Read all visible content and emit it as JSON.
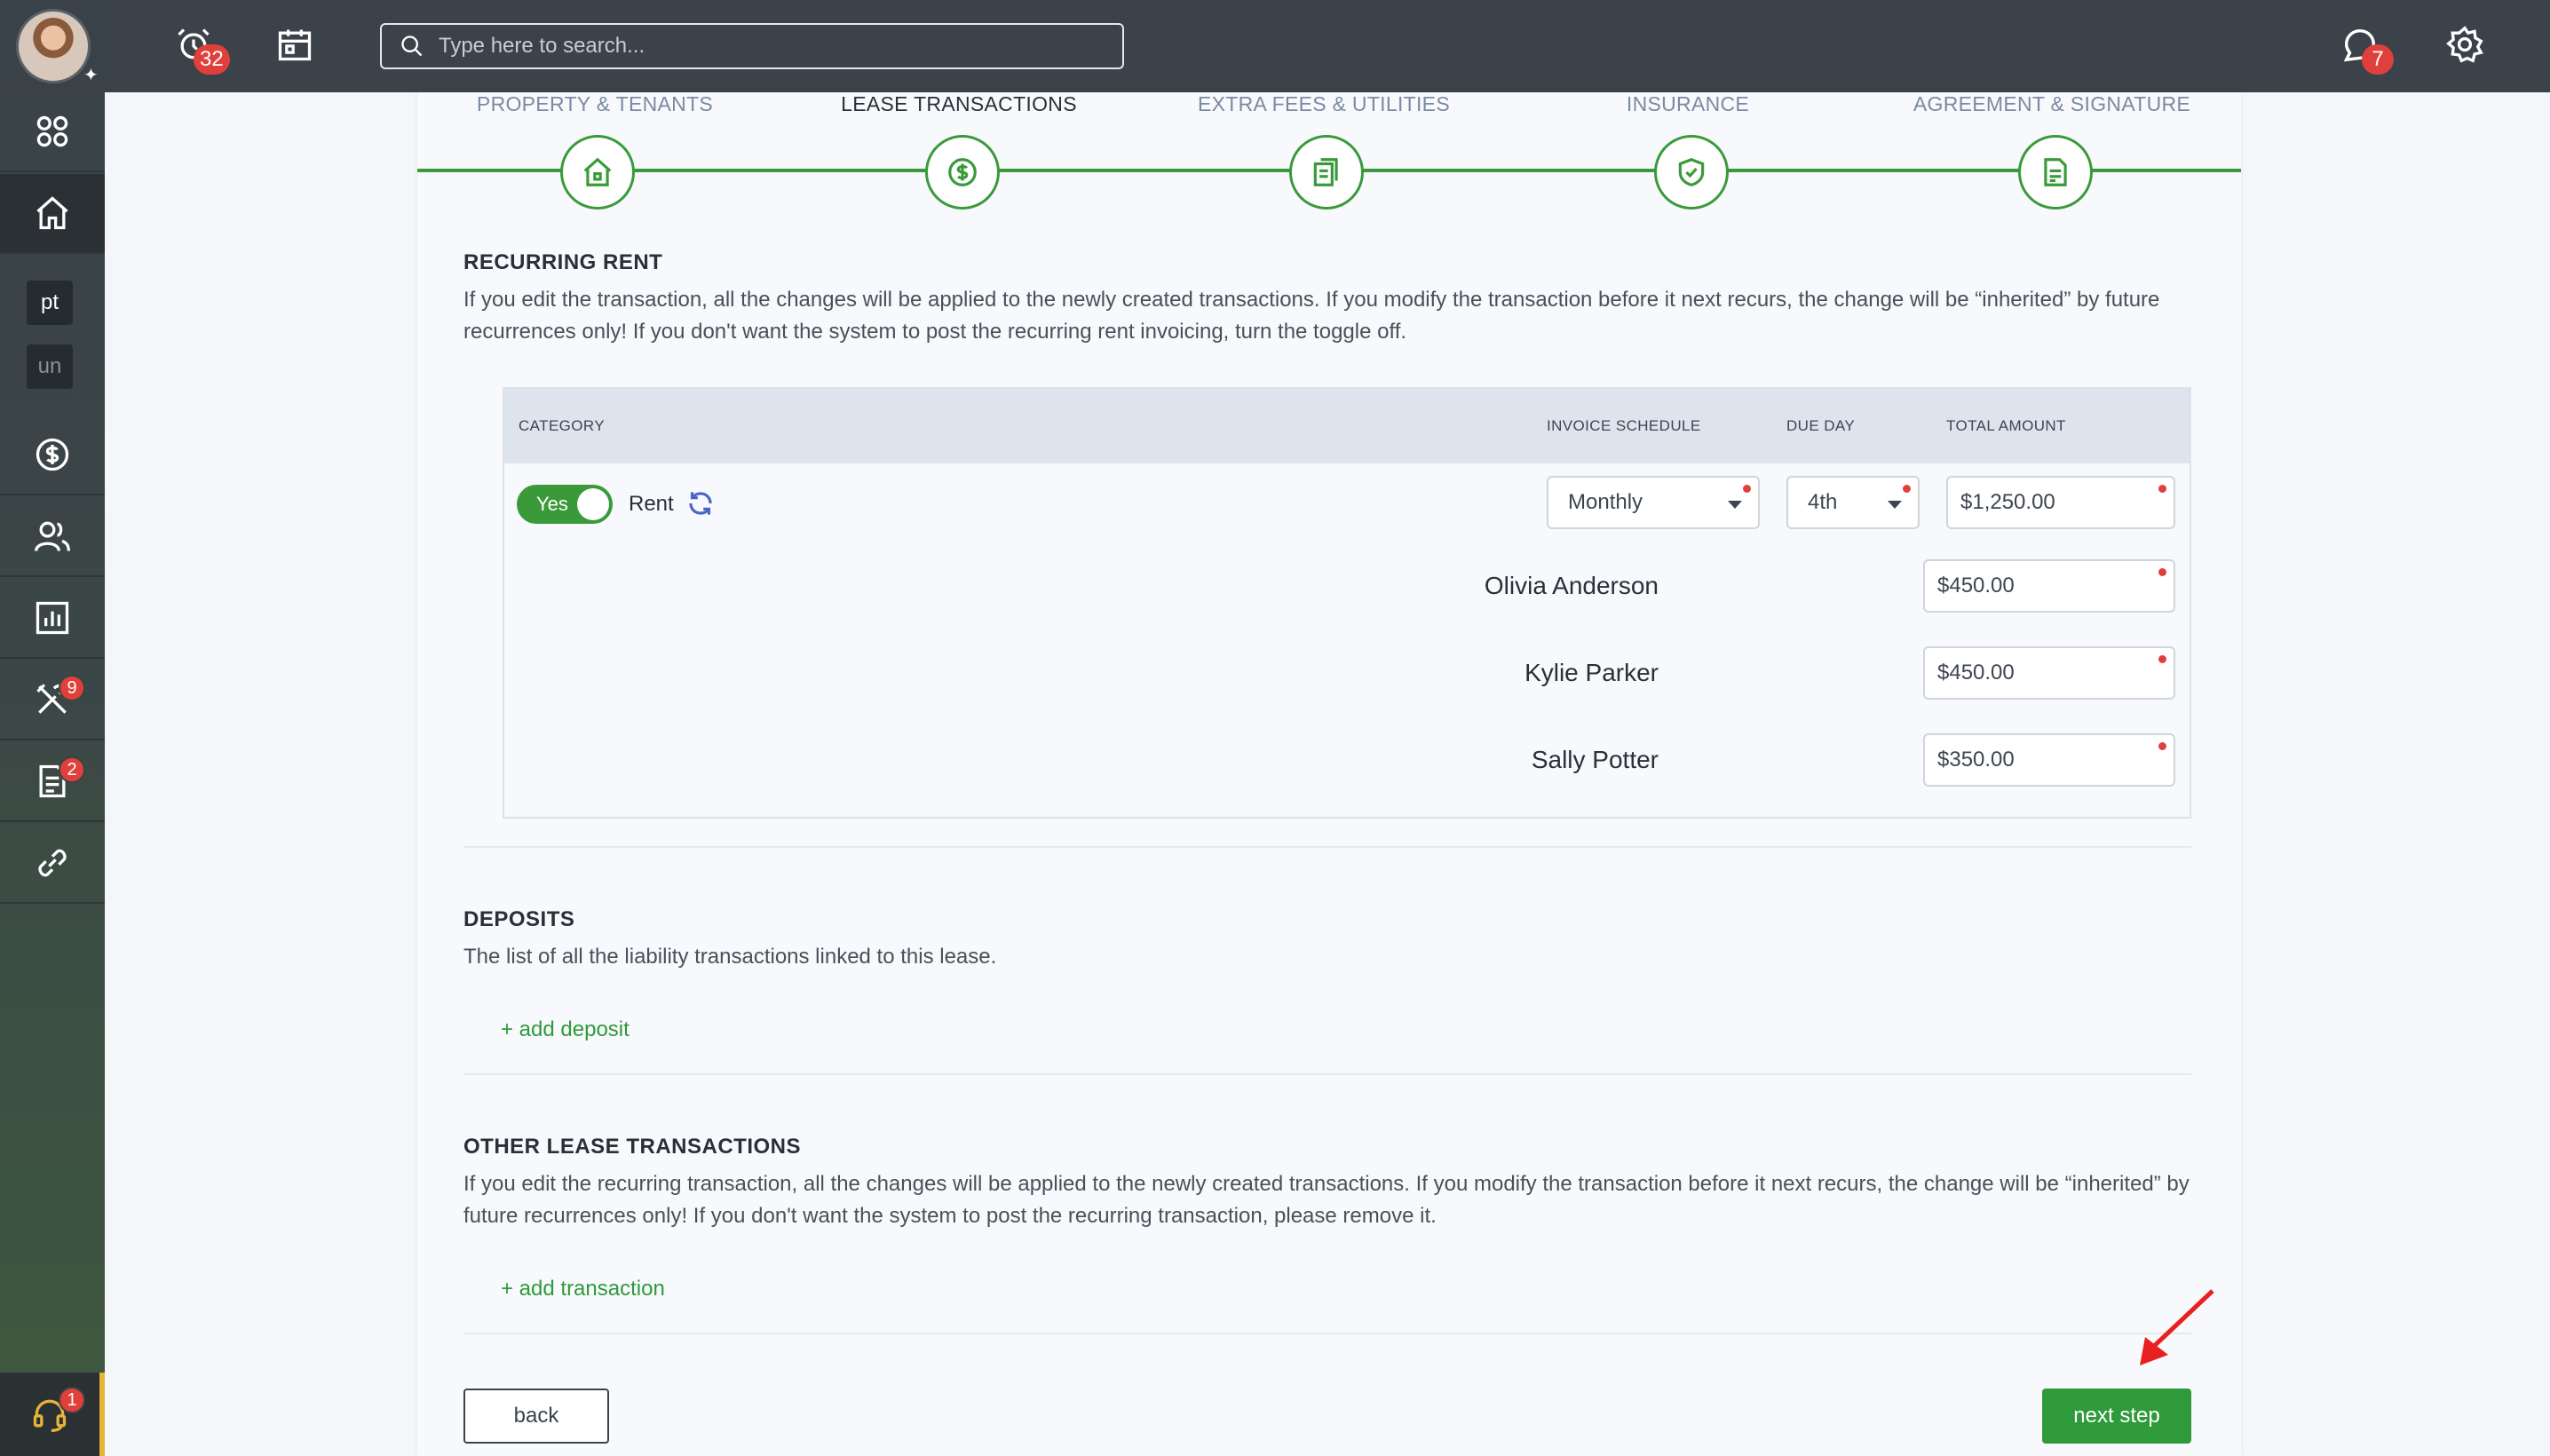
{
  "sidebar": {
    "chips": [
      "pt",
      "un"
    ],
    "badges": {
      "tools": "9",
      "documents": "2",
      "support": "1"
    }
  },
  "topbar": {
    "alarm_badge": "32",
    "chat_badge": "7",
    "search_placeholder": "Type here to search..."
  },
  "stepper": {
    "steps": [
      {
        "label": "PROPERTY & TENANTS",
        "icon": "house-icon"
      },
      {
        "label": "LEASE TRANSACTIONS",
        "icon": "dollar-icon"
      },
      {
        "label": "EXTRA FEES & UTILITIES",
        "icon": "documents-icon"
      },
      {
        "label": "INSURANCE",
        "icon": "shield-icon"
      },
      {
        "label": "AGREEMENT & SIGNATURE",
        "icon": "file-icon"
      }
    ],
    "active_index": 1
  },
  "recurring_rent": {
    "title": "RECURRING RENT",
    "description": "If you edit the transaction, all the changes will be applied to the newly created transactions. If you modify the transaction before it next recurs, the change will be “inherited” by future recurrences only! If you don't want the system to post the recurring rent invoicing, turn the toggle off.",
    "table": {
      "headers": {
        "category": "CATEGORY",
        "invoice_schedule": "INVOICE SCHEDULE",
        "due_day": "DUE DAY",
        "total_amount": "TOTAL AMOUNT"
      },
      "toggle_label": "Yes",
      "category": "Rent",
      "invoice_schedule": "Monthly",
      "due_day": "4th",
      "total_amount": "$1,250.00",
      "tenants": [
        {
          "name": "Olivia Anderson",
          "amount": "$450.00"
        },
        {
          "name": "Kylie Parker",
          "amount": "$450.00"
        },
        {
          "name": "Sally Potter",
          "amount": "$350.00"
        }
      ]
    }
  },
  "deposits": {
    "title": "DEPOSITS",
    "description": "The list of all the liability transactions linked to this lease.",
    "add_label": "+ add deposit"
  },
  "other_transactions": {
    "title": "OTHER LEASE TRANSACTIONS",
    "description": "If you edit the recurring transaction, all the changes will be applied to the newly created transactions. If you modify the transaction before it next recurs, the change will be “inherited” by future recurrences only! If you don't want the system to post the recurring transaction, please remove it.",
    "add_label": "+ add transaction"
  },
  "footer": {
    "back_label": "back",
    "next_label": "next step"
  },
  "colors": {
    "accent_green": "#2f9a3a",
    "topbar": "#3b4249",
    "badge_red": "#e0403b",
    "annotation_arrow": "#e8201f"
  }
}
